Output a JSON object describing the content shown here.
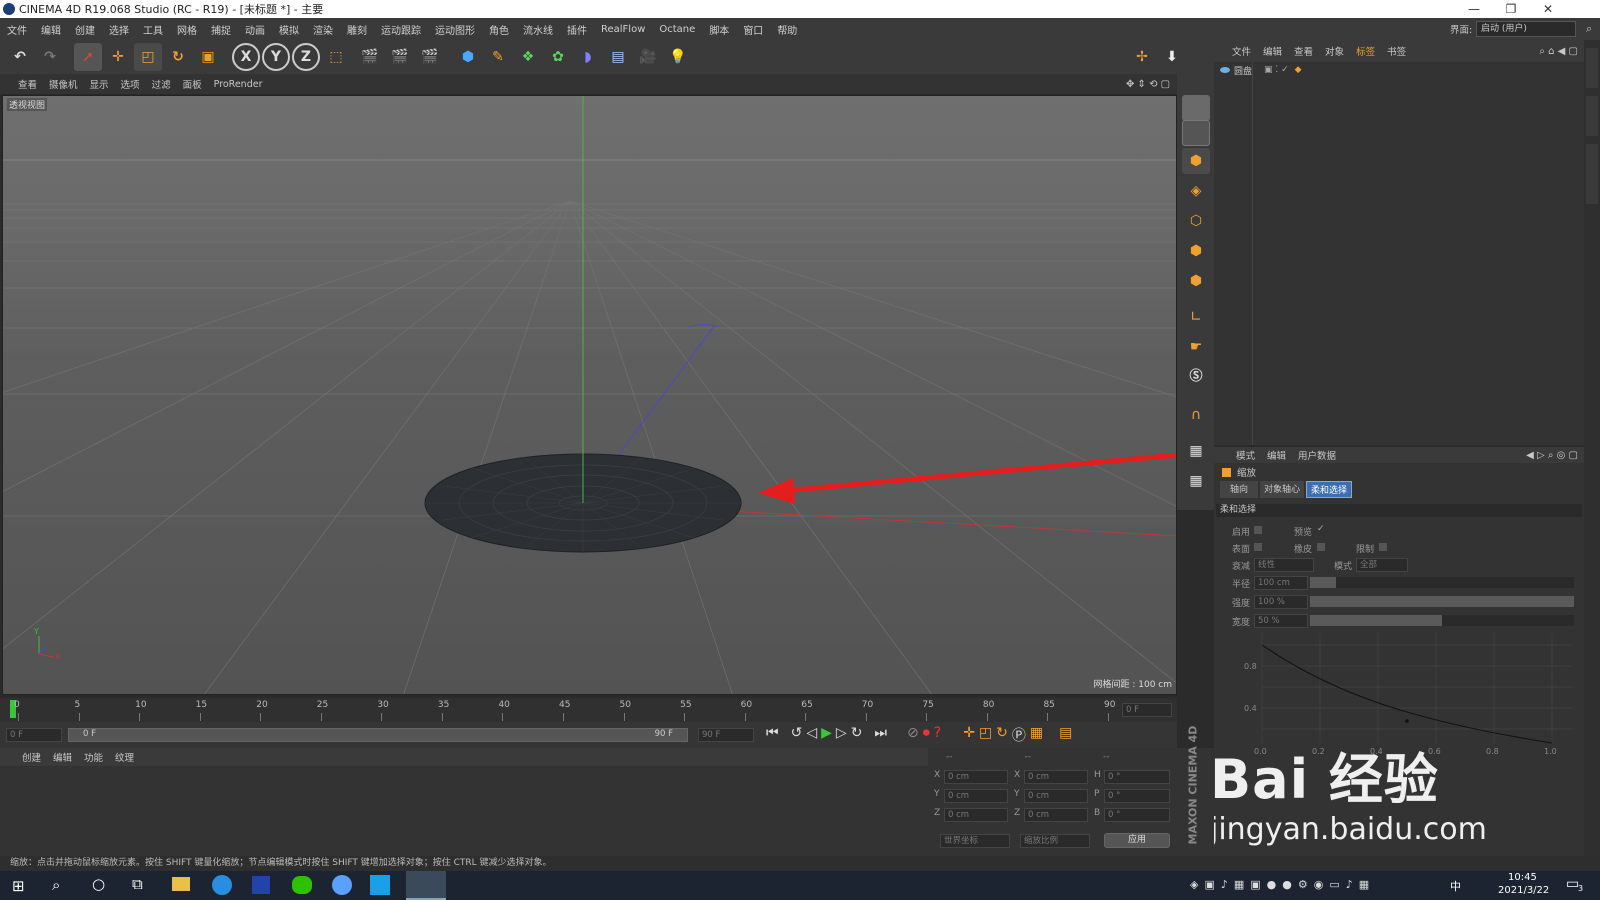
{
  "window": {
    "title": "CINEMA 4D R19.068 Studio (RC - R19) - [未标题 *] - 主要",
    "interface_label": "界面:",
    "interface_value": "启动 (用户)"
  },
  "menu": [
    "文件",
    "编辑",
    "创建",
    "选择",
    "工具",
    "网格",
    "捕捉",
    "动画",
    "模拟",
    "渲染",
    "雕刻",
    "运动跟踪",
    "运动图形",
    "角色",
    "流水线",
    "插件",
    "RealFlow",
    "Octane",
    "脚本",
    "窗口",
    "帮助"
  ],
  "viewport_menu": [
    "查看",
    "摄像机",
    "显示",
    "选项",
    "过滤",
    "面板",
    "ProRender"
  ],
  "viewport": {
    "label": "透视视图",
    "grid_spacing": "网格间距 : 100 cm"
  },
  "object_manager": {
    "tabs": [
      "文件",
      "编辑",
      "查看",
      "对象",
      "标签",
      "书签"
    ],
    "object_name": "圆盘"
  },
  "attributes": {
    "tabs": [
      "模式",
      "编辑",
      "用户数据"
    ],
    "tool_name": "缩放",
    "subtabs": [
      "轴向",
      "对象轴心",
      "柔和选择"
    ],
    "section": "柔和选择",
    "enable": "启用",
    "preview": "预览",
    "surface": "表面",
    "rubber": "橡皮",
    "restrict": "限制",
    "falloff_label": "衰减",
    "falloff_value": "线性",
    "mode_label": "模式",
    "mode_value": "全部",
    "radius_label": "半径",
    "radius_value": "100 cm",
    "strength_label": "强度",
    "strength_value": "100 %",
    "width_label": "宽度",
    "width_value": "50 %",
    "graph_y": [
      "0.8",
      "0.4"
    ],
    "graph_x": [
      "0.0",
      "0.2",
      "0.4",
      "0.6",
      "0.8",
      "1.0"
    ]
  },
  "timeline": {
    "ticks": [
      "0",
      "5",
      "10",
      "15",
      "20",
      "25",
      "30",
      "35",
      "40",
      "45",
      "50",
      "55",
      "60",
      "65",
      "70",
      "75",
      "80",
      "85",
      "90"
    ],
    "end_field": "0 F"
  },
  "transport": {
    "current": "0 F",
    "start": "0 F",
    "end_slider": "90 F",
    "end": "90 F"
  },
  "material": {
    "tabs": [
      "创建",
      "编辑",
      "功能",
      "纹理"
    ]
  },
  "coords": {
    "header": [
      "--",
      "--",
      "--"
    ],
    "rows": [
      {
        "a": "X",
        "av": "0 cm",
        "b": "X",
        "bv": "0 cm",
        "c": "H",
        "cv": "0 °"
      },
      {
        "a": "Y",
        "av": "0 cm",
        "b": "Y",
        "bv": "0 cm",
        "c": "P",
        "cv": "0 °"
      },
      {
        "a": "Z",
        "av": "0 cm",
        "b": "Z",
        "bv": "0 cm",
        "c": "B",
        "cv": "0 °"
      }
    ],
    "world": "世界坐标",
    "scale": "缩放比例",
    "apply": "应用"
  },
  "brand": "MAXON CINEMA 4D",
  "status": "缩放：点击并拖动鼠标缩放元素。按住 SHIFT 键量化缩放；节点编辑模式时按住 SHIFT 键增加选择对象；按住 CTRL 键减少选择对象。",
  "watermark": {
    "brand": "Bai 经验",
    "url": "jingyan.baidu.com"
  },
  "clock": {
    "time": "10:45",
    "date": "2021/3/22",
    "tray_lang": "中",
    "notif_count": "3"
  },
  "colors": {
    "accent_orange": "#f0a030",
    "selection_blue": "#3c6eb4",
    "arrow_red": "#e41e1e"
  }
}
